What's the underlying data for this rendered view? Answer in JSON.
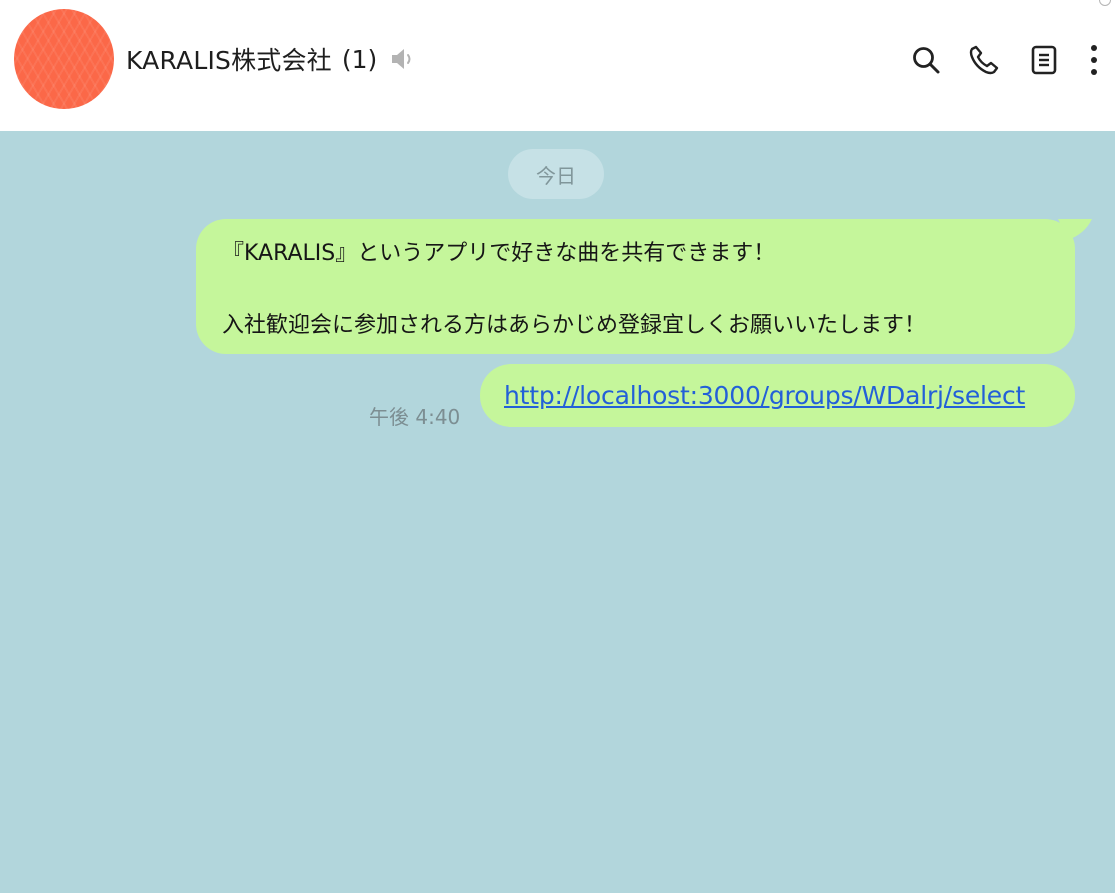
{
  "header": {
    "chat_name": "KARALIS株式会社",
    "member_count": "(1)",
    "icons": [
      "mute-icon",
      "search-icon",
      "phone-icon",
      "notes-icon",
      "more-icon"
    ]
  },
  "colors": {
    "avatar": "#fb6848",
    "chat_background": "#b2d6dc",
    "bubble": "#c5f69b",
    "link": "#2360d8"
  },
  "chat": {
    "date_label": "今日",
    "messages": [
      {
        "lines": [
          "『KARALIS』というアプリで好きな曲を共有できます！",
          "",
          "入社歓迎会に参加される方はあらかじめ登録宜しくお願いいたします！"
        ]
      },
      {
        "link": "http://localhost:3000/groups/WDalrj/select",
        "time": "午後 4:40"
      }
    ]
  }
}
